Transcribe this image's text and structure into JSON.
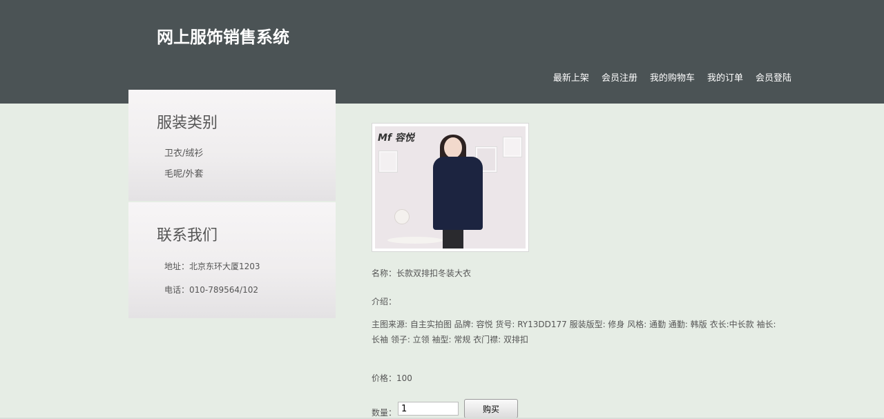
{
  "header": {
    "site_title": "网上服饰销售系统",
    "nav": [
      "最新上架",
      "会员注册",
      "我的购物车",
      "我的订单",
      "会员登陆"
    ]
  },
  "sidebar": {
    "category_title": "服装类别",
    "categories": [
      "卫衣/绒衫",
      "毛呢/外套"
    ],
    "contact_title": "联系我们",
    "contact": {
      "address": "地址：北京东环大厦1203",
      "phone": "电话：010-789564/102"
    }
  },
  "product": {
    "image_brand": "Mf 容悦",
    "name_label": "名称：",
    "name": "长款双排扣冬装大衣",
    "intro_label": "介绍：",
    "description": "主图来源: 自主实拍图 品牌: 容悦 货号: RY13DD177 服装版型: 修身 风格: 通勤 通勤: 韩版 衣长:中长款 袖长: 长袖 领子: 立领 袖型: 常规 衣门襟: 双排扣",
    "price_label": "价格：",
    "price": "100",
    "qty_label": "数量：",
    "qty_value": "1",
    "buy_label": "购买"
  }
}
